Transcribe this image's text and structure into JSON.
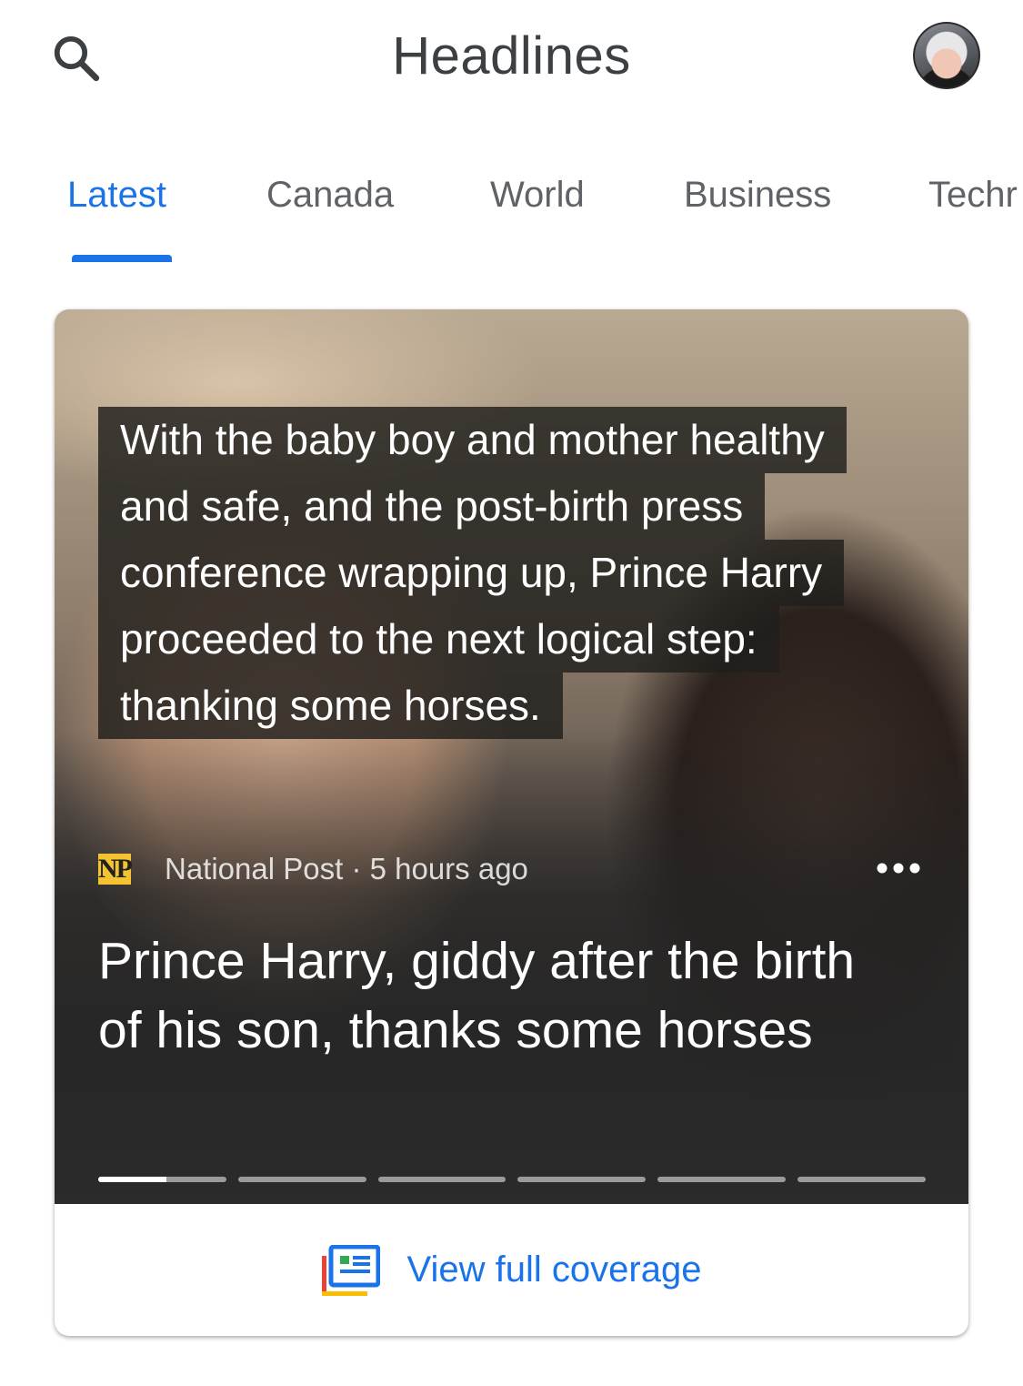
{
  "header": {
    "title": "Headlines",
    "search_icon": "search-icon",
    "avatar_icon": "profile-avatar"
  },
  "tabs": [
    {
      "label": "Latest",
      "active": true
    },
    {
      "label": "Canada",
      "active": false
    },
    {
      "label": "World",
      "active": false
    },
    {
      "label": "Business",
      "active": false
    },
    {
      "label": "Techr",
      "active": false
    }
  ],
  "card": {
    "quote_lines": [
      "With the baby boy and mother healthy",
      "and safe, and the post-birth press",
      "conference wrapping up, Prince Harry",
      "proceeded to the next logical step:",
      "thanking some horses."
    ],
    "source_logo_text": "NP",
    "source_meta": "National Post · 5 hours ago",
    "headline": "Prince Harry, giddy after the birth of his son, thanks some horses",
    "progress": {
      "segments": 6,
      "current": 1,
      "current_fill": 0.53
    },
    "coverage_label": "View full coverage"
  },
  "colors": {
    "accent": "#1a73e8",
    "text_gray": "#5f6368",
    "title": "#3c4043",
    "np_logo": "#f4c430"
  }
}
